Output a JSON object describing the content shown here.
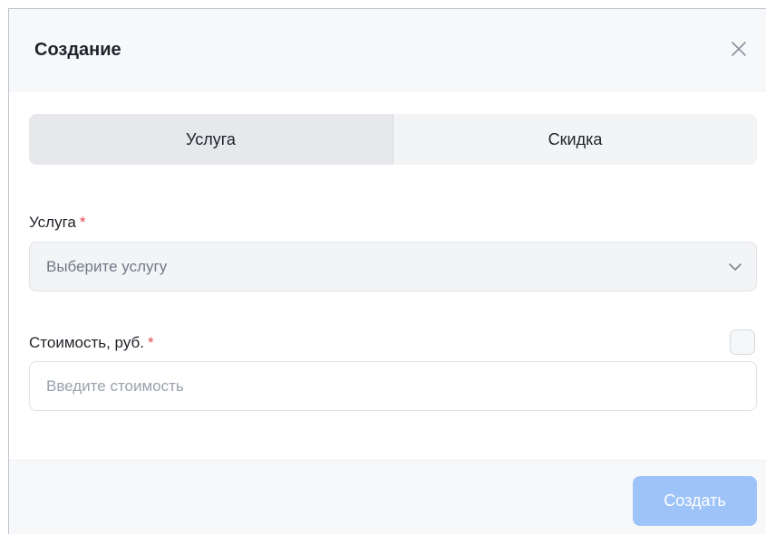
{
  "modal": {
    "title": "Создание",
    "close_icon": "close-icon"
  },
  "tabs": [
    {
      "label": "Услуга",
      "active": true
    },
    {
      "label": "Скидка",
      "active": false
    }
  ],
  "service_field": {
    "label": "Услуга",
    "required_mark": "*",
    "placeholder": "Выберите услугу",
    "icon": "chevron-down-icon"
  },
  "cost_field": {
    "label": "Стоимость, руб.",
    "required_mark": "*",
    "placeholder": "Введите стоимость",
    "value": "",
    "checkbox_checked": false
  },
  "footer": {
    "create_label": "Создать"
  },
  "colors": {
    "accent_disabled": "#9dc3f8",
    "required": "#e5484d"
  }
}
